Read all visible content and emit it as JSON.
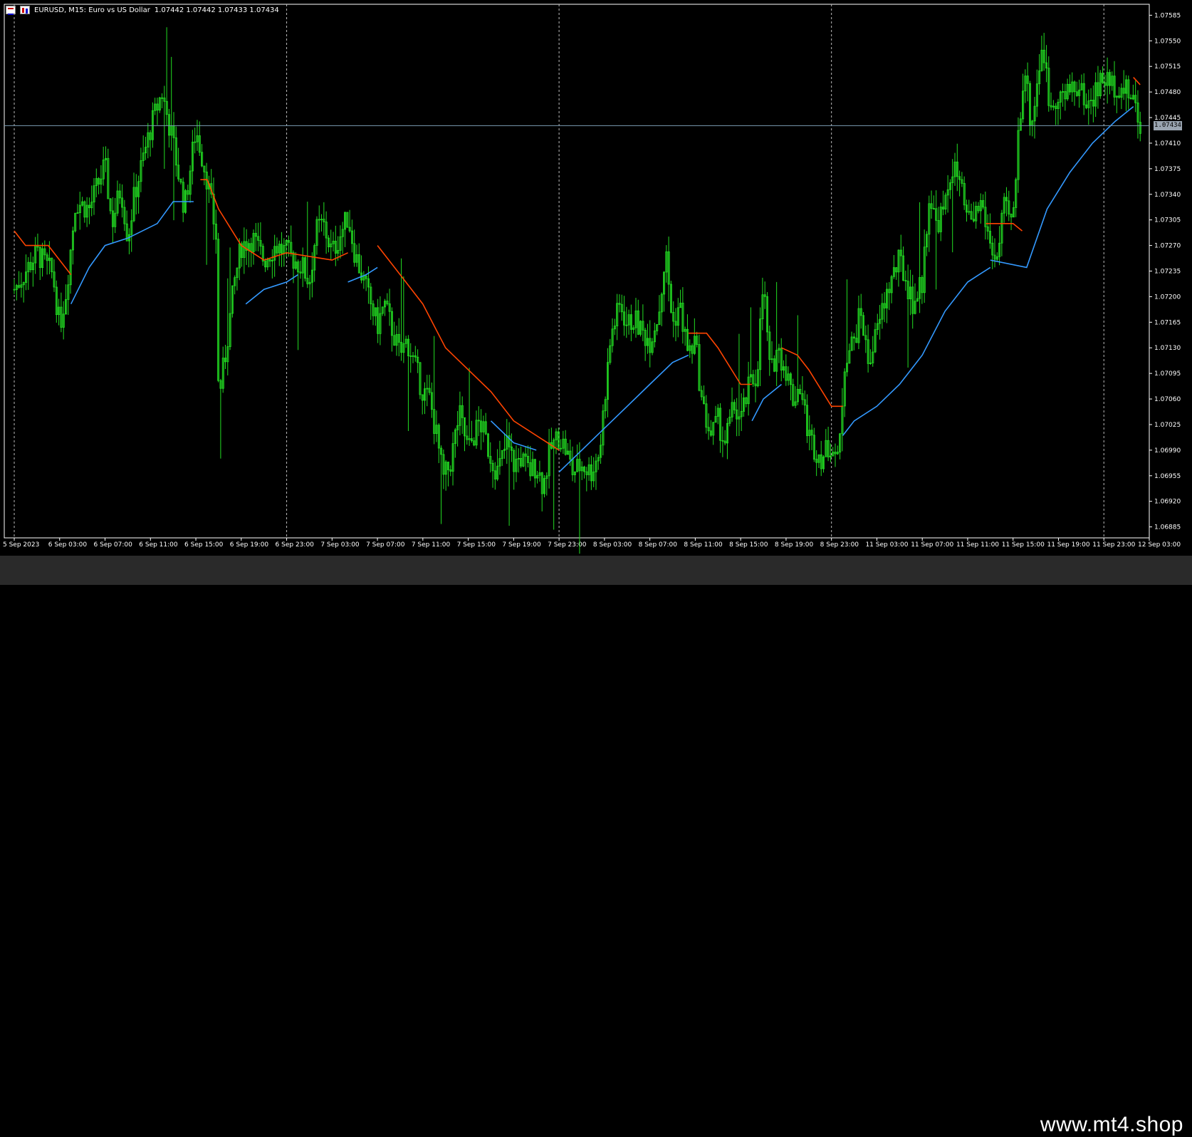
{
  "header": {
    "symbol_text": "EURUSD, M15:  Euro vs US Dollar",
    "ohlc_text": "1.07442 1.07442 1.07433 1.07434"
  },
  "current_price": "1.07434",
  "watermark": "www.mt4.shop",
  "colors": {
    "background": "#000000",
    "candle": "#22dd22",
    "ma_up": "#3399ff",
    "ma_down": "#ff4400",
    "grid": "#bbbbbb",
    "price_line": "#7b9bb5",
    "axis_text": "#ffffff"
  },
  "chart_data": {
    "type": "candlestick",
    "title": "",
    "xlabel": "",
    "ylabel": "",
    "ylim": [
      1.0687,
      1.076
    ],
    "yticks": [
      "1.07585",
      "1.07550",
      "1.07515",
      "1.07480",
      "1.07445",
      "1.07410",
      "1.07375",
      "1.07340",
      "1.07305",
      "1.07270",
      "1.07235",
      "1.07200",
      "1.07165",
      "1.07130",
      "1.07095",
      "1.07060",
      "1.07025",
      "1.06990",
      "1.06955",
      "1.06920",
      "1.06885"
    ],
    "xticks": [
      "5 Sep 2023",
      "6 Sep 03:00",
      "6 Sep 07:00",
      "6 Sep 11:00",
      "6 Sep 15:00",
      "6 Sep 19:00",
      "6 Sep 23:00",
      "7 Sep 03:00",
      "7 Sep 07:00",
      "7 Sep 11:00",
      "7 Sep 15:00",
      "7 Sep 19:00",
      "7 Sep 23:00",
      "8 Sep 03:00",
      "8 Sep 07:00",
      "8 Sep 11:00",
      "8 Sep 15:00",
      "8 Sep 19:00",
      "8 Sep 23:00",
      "11 Sep 03:00",
      "11 Sep 07:00",
      "11 Sep 11:00",
      "11 Sep 15:00",
      "11 Sep 19:00",
      "11 Sep 23:00",
      "12 Sep 03:00"
    ],
    "day_separators_at_tick": [
      0,
      6,
      12,
      18,
      24
    ],
    "price_line": 1.07434,
    "price_path": [
      [
        0,
        1.0721
      ],
      [
        1,
        1.0726
      ],
      [
        1.7,
        1.0723
      ],
      [
        2,
        1.0716
      ],
      [
        2.3,
        1.0721
      ],
      [
        2.7,
        1.0733
      ],
      [
        3.3,
        1.0732
      ],
      [
        4,
        1.0738
      ],
      [
        4.3,
        1.073
      ],
      [
        4.7,
        1.0735
      ],
      [
        5,
        1.0728
      ],
      [
        5.3,
        1.0734
      ],
      [
        6,
        1.0743
      ],
      [
        6.5,
        1.0748
      ],
      [
        7,
        1.0741
      ],
      [
        7.5,
        1.0732
      ],
      [
        8,
        1.0743
      ],
      [
        8.5,
        1.0736
      ],
      [
        8.9,
        1.0728
      ],
      [
        9,
        1.0706
      ],
      [
        9.3,
        1.0712
      ],
      [
        9.7,
        1.0722
      ],
      [
        10,
        1.0727
      ],
      [
        10.5,
        1.0728
      ],
      [
        11,
        1.0725
      ],
      [
        11.5,
        1.0727
      ],
      [
        12,
        1.0726
      ],
      [
        12.7,
        1.0724
      ],
      [
        13,
        1.0722
      ],
      [
        13.3,
        1.0729
      ],
      [
        13.6,
        1.073
      ],
      [
        14,
        1.0726
      ],
      [
        14.3,
        1.0728
      ],
      [
        14.7,
        1.0731
      ],
      [
        15,
        1.0726
      ],
      [
        15.3,
        1.0723
      ],
      [
        15.7,
        1.0719
      ],
      [
        16,
        1.0716
      ],
      [
        16.3,
        1.0719
      ],
      [
        16.7,
        1.0715
      ],
      [
        17,
        1.0712
      ],
      [
        17.3,
        1.0714
      ],
      [
        17.7,
        1.071
      ],
      [
        18,
        1.0707
      ],
      [
        18.3,
        1.0706
      ],
      [
        18.6,
        1.0701
      ],
      [
        18.9,
        1.0695
      ],
      [
        19.2,
        1.0697
      ],
      [
        19.6,
        1.0704
      ],
      [
        20,
        1.0699
      ],
      [
        20.5,
        1.0703
      ],
      [
        21,
        1.0698
      ],
      [
        21.3,
        1.0696
      ],
      [
        21.7,
        1.07
      ],
      [
        22,
        1.0697
      ],
      [
        22.3,
        1.0698
      ],
      [
        22.7,
        1.0696
      ],
      [
        23,
        1.0697
      ],
      [
        23.3,
        1.0694
      ],
      [
        23.6,
        1.0699
      ],
      [
        24,
        1.0701
      ],
      [
        24.3,
        1.0699
      ],
      [
        24.6,
        1.0696
      ],
      [
        25,
        1.0697
      ],
      [
        25.4,
        1.0696
      ],
      [
        25.8,
        1.0699
      ],
      [
        26,
        1.0706
      ],
      [
        26.3,
        1.0715
      ],
      [
        26.7,
        1.0719
      ],
      [
        27,
        1.0716
      ],
      [
        27.3,
        1.0717
      ],
      [
        27.7,
        1.0715
      ],
      [
        28,
        1.0714
      ],
      [
        28.4,
        1.0718
      ],
      [
        28.7,
        1.0726
      ],
      [
        29,
        1.0716
      ],
      [
        29.3,
        1.0719
      ],
      [
        29.7,
        1.0712
      ],
      [
        30,
        1.0714
      ],
      [
        30.3,
        1.0705
      ],
      [
        30.7,
        1.0701
      ],
      [
        31,
        1.0703
      ],
      [
        31.3,
        1.07
      ],
      [
        31.7,
        1.0705
      ],
      [
        32,
        1.0703
      ],
      [
        32.4,
        1.0708
      ],
      [
        32.7,
        1.0709
      ],
      [
        33,
        1.0722
      ],
      [
        33.3,
        1.0709
      ],
      [
        33.6,
        1.0713
      ],
      [
        34,
        1.071
      ],
      [
        34.3,
        1.0706
      ],
      [
        34.6,
        1.0708
      ],
      [
        35,
        1.0701
      ],
      [
        35.3,
        1.0699
      ],
      [
        35.6,
        1.0698
      ],
      [
        36,
        1.07
      ],
      [
        36.3,
        1.0697
      ],
      [
        36.6,
        1.0712
      ],
      [
        37,
        1.0714
      ],
      [
        37.3,
        1.0718
      ],
      [
        37.6,
        1.0711
      ],
      [
        38,
        1.0715
      ],
      [
        38.3,
        1.0719
      ],
      [
        38.6,
        1.0722
      ],
      [
        39,
        1.0725
      ],
      [
        39.3,
        1.0722
      ],
      [
        39.6,
        1.0719
      ],
      [
        40,
        1.0722
      ],
      [
        40.3,
        1.0734
      ],
      [
        40.6,
        1.073
      ],
      [
        41,
        1.0732
      ],
      [
        41.3,
        1.0738
      ],
      [
        41.6,
        1.0736
      ],
      [
        42,
        1.073
      ],
      [
        42.3,
        1.0731
      ],
      [
        42.6,
        1.0733
      ],
      [
        43,
        1.0727
      ],
      [
        43.3,
        1.0725
      ],
      [
        43.6,
        1.0732
      ],
      [
        44,
        1.073
      ],
      [
        44.2,
        1.0741
      ],
      [
        44.5,
        1.0752
      ],
      [
        44.8,
        1.0743
      ],
      [
        45,
        1.0748
      ],
      [
        45.3,
        1.0755
      ],
      [
        45.6,
        1.0746
      ],
      [
        46,
        1.0748
      ],
      [
        46.3,
        1.0747
      ],
      [
        46.6,
        1.0749
      ],
      [
        47,
        1.0748
      ],
      [
        47.3,
        1.0746
      ],
      [
        47.6,
        1.0748
      ],
      [
        48,
        1.075
      ],
      [
        48.3,
        1.0749
      ],
      [
        48.6,
        1.0749
      ],
      [
        49,
        1.0748
      ],
      [
        49.3,
        1.0747
      ],
      [
        49.6,
        1.07434
      ]
    ],
    "ma_series": [
      {
        "color": "ma_down",
        "values": [
          [
            0,
            1.0729
          ],
          [
            0.5,
            1.0727
          ],
          [
            1.5,
            1.0727
          ],
          [
            2.5,
            1.0723
          ]
        ]
      },
      {
        "color": "ma_up",
        "values": [
          [
            2.5,
            1.0719
          ],
          [
            3.3,
            1.0724
          ],
          [
            4,
            1.0727
          ],
          [
            5,
            1.0728
          ],
          [
            6.3,
            1.073
          ],
          [
            7,
            1.0733
          ],
          [
            7.9,
            1.0733
          ]
        ]
      },
      {
        "color": "ma_down",
        "values": [
          [
            8.2,
            1.0736
          ],
          [
            8.5,
            1.0736
          ],
          [
            9,
            1.0732
          ],
          [
            10,
            1.0727
          ],
          [
            11,
            1.0725
          ],
          [
            12,
            1.0726
          ],
          [
            14,
            1.0725
          ],
          [
            14.7,
            1.0726
          ]
        ]
      },
      {
        "color": "ma_up",
        "values": [
          [
            10.2,
            1.0719
          ],
          [
            11,
            1.0721
          ],
          [
            12,
            1.0722
          ],
          [
            12.5,
            1.0723
          ]
        ]
      },
      {
        "color": "ma_up",
        "values": [
          [
            14.7,
            1.0722
          ],
          [
            15.5,
            1.0723
          ],
          [
            16,
            1.0724
          ]
        ]
      },
      {
        "color": "ma_down",
        "values": [
          [
            16,
            1.0727
          ],
          [
            17,
            1.0723
          ],
          [
            18,
            1.0719
          ],
          [
            19,
            1.0713
          ],
          [
            21,
            1.0707
          ],
          [
            22,
            1.0703
          ],
          [
            24,
            1.0699
          ]
        ]
      },
      {
        "color": "ma_up",
        "values": [
          [
            21,
            1.0703
          ],
          [
            22,
            1.07
          ],
          [
            23,
            1.0699
          ]
        ]
      },
      {
        "color": "ma_up",
        "values": [
          [
            24,
            1.0696
          ],
          [
            25,
            1.0699
          ],
          [
            26,
            1.0702
          ],
          [
            27,
            1.0705
          ],
          [
            28,
            1.0708
          ],
          [
            29,
            1.0711
          ],
          [
            29.7,
            1.0712
          ]
        ]
      },
      {
        "color": "ma_down",
        "values": [
          [
            29.7,
            1.0715
          ],
          [
            30.5,
            1.0715
          ],
          [
            31,
            1.0713
          ],
          [
            32,
            1.0708
          ],
          [
            32.5,
            1.0708
          ]
        ]
      },
      {
        "color": "ma_up",
        "values": [
          [
            32.5,
            1.0703
          ],
          [
            33,
            1.0706
          ],
          [
            33.8,
            1.0708
          ]
        ]
      },
      {
        "color": "ma_down",
        "values": [
          [
            33.8,
            1.0713
          ],
          [
            34.5,
            1.0712
          ],
          [
            35,
            1.071
          ],
          [
            36,
            1.0705
          ],
          [
            36.5,
            1.0705
          ]
        ]
      },
      {
        "color": "ma_up",
        "values": [
          [
            36.5,
            1.0701
          ],
          [
            37,
            1.0703
          ],
          [
            38,
            1.0705
          ],
          [
            39,
            1.0708
          ],
          [
            40,
            1.0712
          ],
          [
            41,
            1.0718
          ],
          [
            42,
            1.0722
          ],
          [
            42.5,
            1.0723
          ],
          [
            43,
            1.0724
          ]
        ]
      },
      {
        "color": "ma_down",
        "values": [
          [
            42.8,
            1.073
          ],
          [
            44,
            1.073
          ],
          [
            44.4,
            1.0729
          ]
        ]
      },
      {
        "color": "ma_up",
        "values": [
          [
            43,
            1.0725
          ],
          [
            44.6,
            1.0724
          ],
          [
            45.5,
            1.0732
          ],
          [
            46.5,
            1.0737
          ],
          [
            47.5,
            1.0741
          ],
          [
            48.5,
            1.0744
          ],
          [
            49.3,
            1.0746
          ]
        ]
      },
      {
        "color": "ma_down",
        "values": [
          [
            49.3,
            1.075
          ],
          [
            49.6,
            1.0749
          ]
        ]
      }
    ]
  }
}
